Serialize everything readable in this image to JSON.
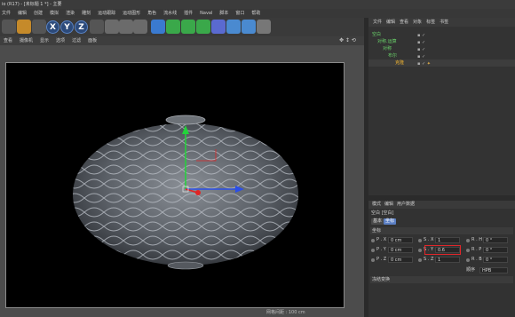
{
  "title": "io (R17) - [未标题 1 *] - 主要",
  "menu": [
    "文件",
    "编辑",
    "创建",
    "模拟",
    "渲染",
    "雕刻",
    "运动跟踪",
    "运动图形",
    "角色",
    "流水线",
    "插件",
    "Naval",
    "脚本",
    "窗口",
    "帮助"
  ],
  "toolbar": {
    "axis_x": "X",
    "axis_y": "Y",
    "axis_z": "Z"
  },
  "viewport": {
    "menu": [
      "查看",
      "摄像机",
      "显示",
      "选项",
      "过滤",
      "面板"
    ],
    "status": "网格间距 : 100 cm"
  },
  "objects_panel": {
    "menu": [
      "文件",
      "编辑",
      "查看",
      "对象",
      "标签",
      "书签"
    ],
    "rows": [
      {
        "name": "空白",
        "selected": false,
        "indent": 1
      },
      {
        "name": "对称.运算",
        "selected": false,
        "indent": 2
      },
      {
        "name": "对称",
        "selected": false,
        "indent": 3
      },
      {
        "name": "布尔",
        "selected": false,
        "indent": 4
      },
      {
        "name": "克隆",
        "selected": true,
        "indent": 5
      }
    ]
  },
  "attributes": {
    "menu": [
      "模式",
      "编辑",
      "用户数据"
    ],
    "object_line": "空白 [空白]",
    "tabs": [
      "基本",
      "坐标"
    ],
    "section_coords": "坐标",
    "rows": [
      {
        "p_label": "P . X",
        "p_value": "0 cm",
        "s_label": "S . X",
        "s_value": "1",
        "r_label": "R . H",
        "r_value": "0 °"
      },
      {
        "p_label": "P . Y",
        "p_value": "0 cm",
        "s_label": "S . Y",
        "s_value": "0.6",
        "r_label": "R . P",
        "r_value": "0 °"
      },
      {
        "p_label": "P . Z",
        "p_value": "0 cm",
        "s_label": "S . Z",
        "s_value": "1",
        "r_label": "R . B",
        "r_value": "0 °"
      }
    ],
    "order_label": "顺序",
    "order_value": "HPB",
    "freeze_section": "冻结变换"
  },
  "colors": {
    "accent": "#5b7fc4",
    "highlight": "#e0262a",
    "object_green": "#6ad36a",
    "object_selected": "#f0b431",
    "axis_y": "#22d43a",
    "axis_x": "#e02525",
    "axis_z": "#2a4ee8"
  }
}
